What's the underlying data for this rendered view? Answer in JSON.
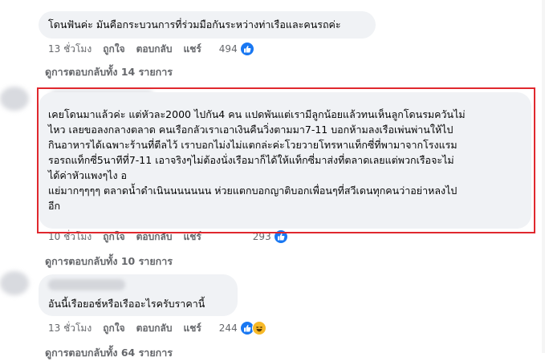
{
  "comments": [
    {
      "lines": [
        "โดนฟันค่ะ มันคือกระบวนการที่ร่วมมือกันระหว่างท่าเรือและคนรถค่ะ"
      ],
      "time": "13 ชั่วโมง",
      "like_label": "ถูกใจ",
      "reply_label": "ตอบกลับ",
      "share_label": "แชร์",
      "reaction_count": "494",
      "reaction_icons": [
        "like-icon"
      ],
      "view_replies": "ดูการตอบกลับทั้ง 14 รายการ"
    },
    {
      "lines": [
        "เคยโดนมาแล้วค่ะ แต่หัวละ2000 ไปกัน4 คน แปดพันแต่เรามีลูกน้อยแล้วทนเห็นลูกโดนรมควันไม่",
        "ไหว เลยขอลงกลางตลาด คนเรือกลัวเราเอาเงินคืนวิ่งตามมา7-11 บอกห้ามลงเรือเพ่นพ่านให้ไป",
        "กินอาหารได้เฉพาะร้านที่ตีลไว้ เราบอกไม่งไม่แตกล่ะค่ะโวยวายโทรหาแท็กซี่ที่พามาจากโรงแรม",
        "รอรถแท็กซี่5นาทีที่7-11 เอาจริงๆไม่ต้องนั่งเรือมาก็ได้ให้แท็กซี่มาส่งที่ตลาดเลยแต่พวกเรือจะไม่",
        "ได้ค่าหัวแพงๆไง อ",
        "แย่มากๆๆๆๆ ตลาดน้ำดำเนินนนนนนน ห่วยแตกบอกญาติบอกเพื่อนๆที่สวีเดนทุกคนว่าอย่าหลงไป",
        "อีก"
      ],
      "time": "10 ชั่วโมง",
      "like_label": "ถูกใจ",
      "reply_label": "ตอบกลับ",
      "share_label": "แชร์",
      "reaction_count": "293",
      "reaction_icons": [
        "like-icon"
      ],
      "view_replies": "ดูการตอบกลับทั้ง 10 รายการ"
    },
    {
      "lines": [
        "อันนี้เรือยอช์หรือเรืออะไรครับราคานี้"
      ],
      "time": "13 ชั่วโมง",
      "like_label": "ถูกใจ",
      "reply_label": "ตอบกลับ",
      "share_label": "แชร์",
      "reaction_count": "244",
      "reaction_icons": [
        "like-icon",
        "haha-icon"
      ],
      "view_replies": "ดูการตอบกลับทั้ง 64 รายการ"
    }
  ],
  "colors": {
    "bubble": "#f0f2f5",
    "meta_text": "#65676b",
    "like_blue": "#1877f2",
    "haha_yellow": "#f7b928",
    "highlight_red": "#e0282e"
  }
}
